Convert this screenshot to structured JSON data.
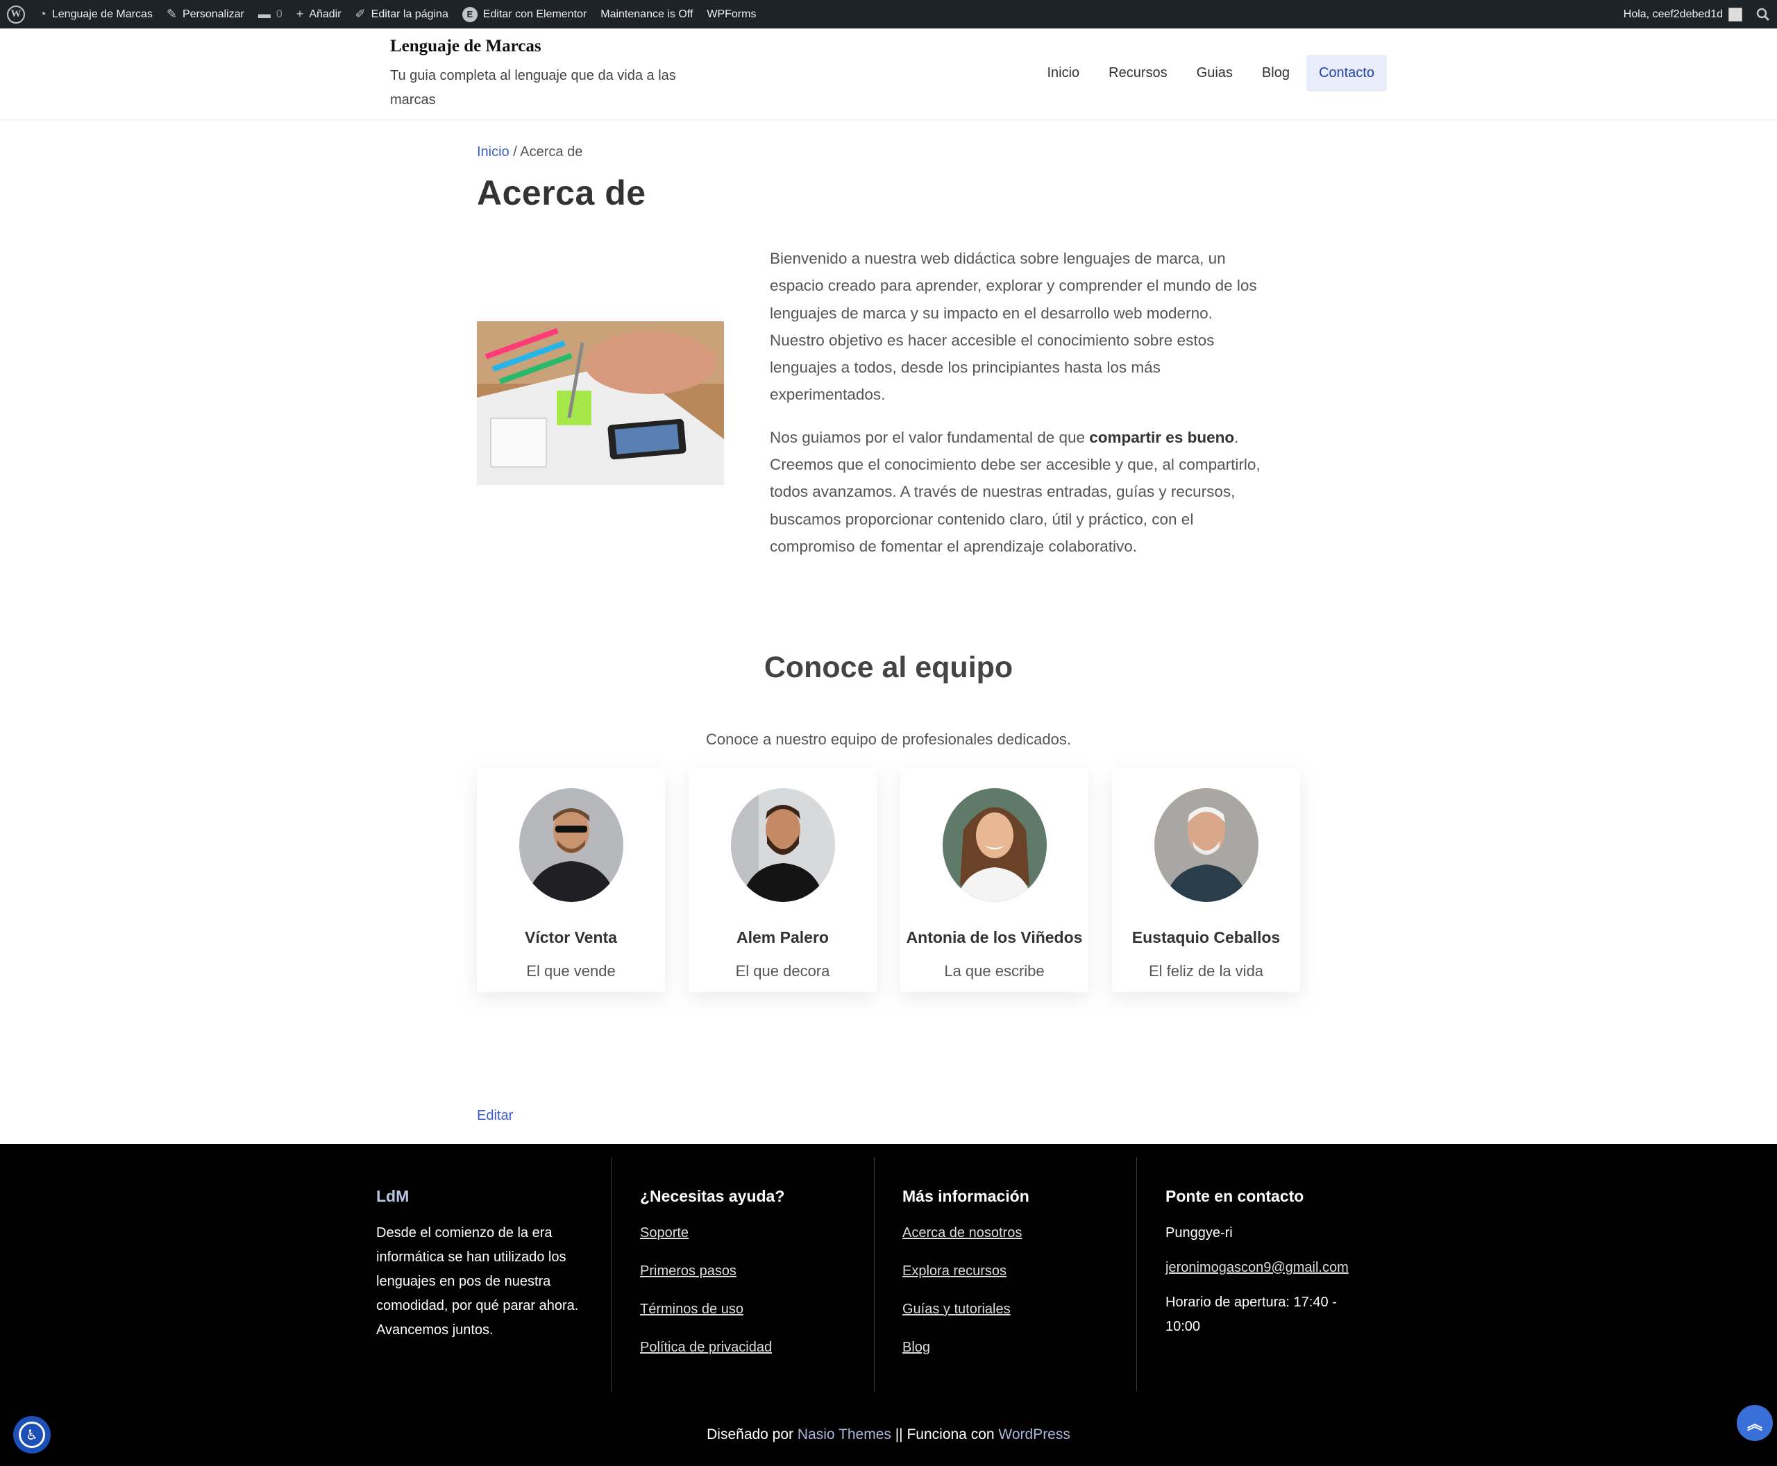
{
  "adminbar": {
    "items": [
      {
        "icon": "wordpress-logo-icon",
        "label": ""
      },
      {
        "icon": "dashboard-icon",
        "label": "Lenguaje de Marcas"
      },
      {
        "icon": "brush-icon",
        "label": "Personalizar"
      },
      {
        "icon": "comment-icon",
        "label": "0"
      },
      {
        "icon": "plus-icon",
        "label": "Añadir"
      },
      {
        "icon": "pencil-icon",
        "label": "Editar la página"
      },
      {
        "icon": "elementor-icon",
        "label": "Editar con Elementor"
      },
      {
        "icon": "",
        "label": "Maintenance is Off"
      },
      {
        "icon": "",
        "label": "WPForms"
      }
    ],
    "greeting": "Hola, ceef2debed1d"
  },
  "header": {
    "site_title": "Lenguaje de Marcas",
    "tagline": "Tu guia completa al lenguaje que da vida a las marcas",
    "nav": [
      "Inicio",
      "Recursos",
      "Guias",
      "Blog",
      "Contacto"
    ],
    "active_nav": "Contacto"
  },
  "breadcrumb": {
    "home": "Inicio",
    "separator": "/",
    "current": "Acerca de"
  },
  "page_title": "Acerca de",
  "about": {
    "p1": "Bienvenido a nuestra web didáctica sobre lenguajes de marca, un espacio creado para aprender, explorar y comprender el mundo de los lenguajes de marca y su impacto en el desarrollo web moderno. Nuestro objetivo es hacer accesible el conocimiento sobre estos lenguajes a todos, desde los principiantes hasta los más experimentados.",
    "p2_before": "Nos guiamos por el valor fundamental de que ",
    "p2_bold": "compartir es bueno",
    "p2_after": ". Creemos que el conocimiento debe ser accesible y que, al compartirlo, todos avanzamos. A través de nuestras entradas, guías y recursos, buscamos proporcionar contenido claro, útil y práctico, con el compromiso de fomentar el aprendizaje colaborativo."
  },
  "team": {
    "title": "Conoce al equipo",
    "subtitle": "Conoce a nuestro equipo de profesionales dedicados.",
    "members": [
      {
        "name": "Víctor Venta",
        "role": "El que vende"
      },
      {
        "name": "Alem Palero",
        "role": "El que decora"
      },
      {
        "name": "Antonia de los Viñedos",
        "role": "La que escribe"
      },
      {
        "name": "Eustaquio Ceballos",
        "role": "El feliz de la vida"
      }
    ]
  },
  "edit_link": "Editar",
  "footer": {
    "col1": {
      "title": "LdM",
      "text": "Desde el comienzo de la era informática se han utilizado los lenguajes en pos de nuestra comodidad, por qué parar ahora. Avancemos juntos."
    },
    "col2": {
      "title": "¿Necesitas ayuda?",
      "links": [
        "Soporte",
        "Primeros pasos",
        "Términos de uso",
        "Política de privacidad"
      ]
    },
    "col3": {
      "title": "Más información",
      "links": [
        "Acerca de nosotros",
        "Explora recursos",
        "Guías y tutoriales",
        "Blog"
      ]
    },
    "col4": {
      "title": "Ponte en contacto",
      "place": "Punggye-ri",
      "email": "jeronimogascon9@gmail.com",
      "hours": "Horario de apertura: 17:40 - 10:00"
    },
    "copyright": {
      "designed_by": "Diseñado por ",
      "theme": "Nasio Themes",
      "mid": " || Funciona con ",
      "powered": "WordPress"
    }
  }
}
